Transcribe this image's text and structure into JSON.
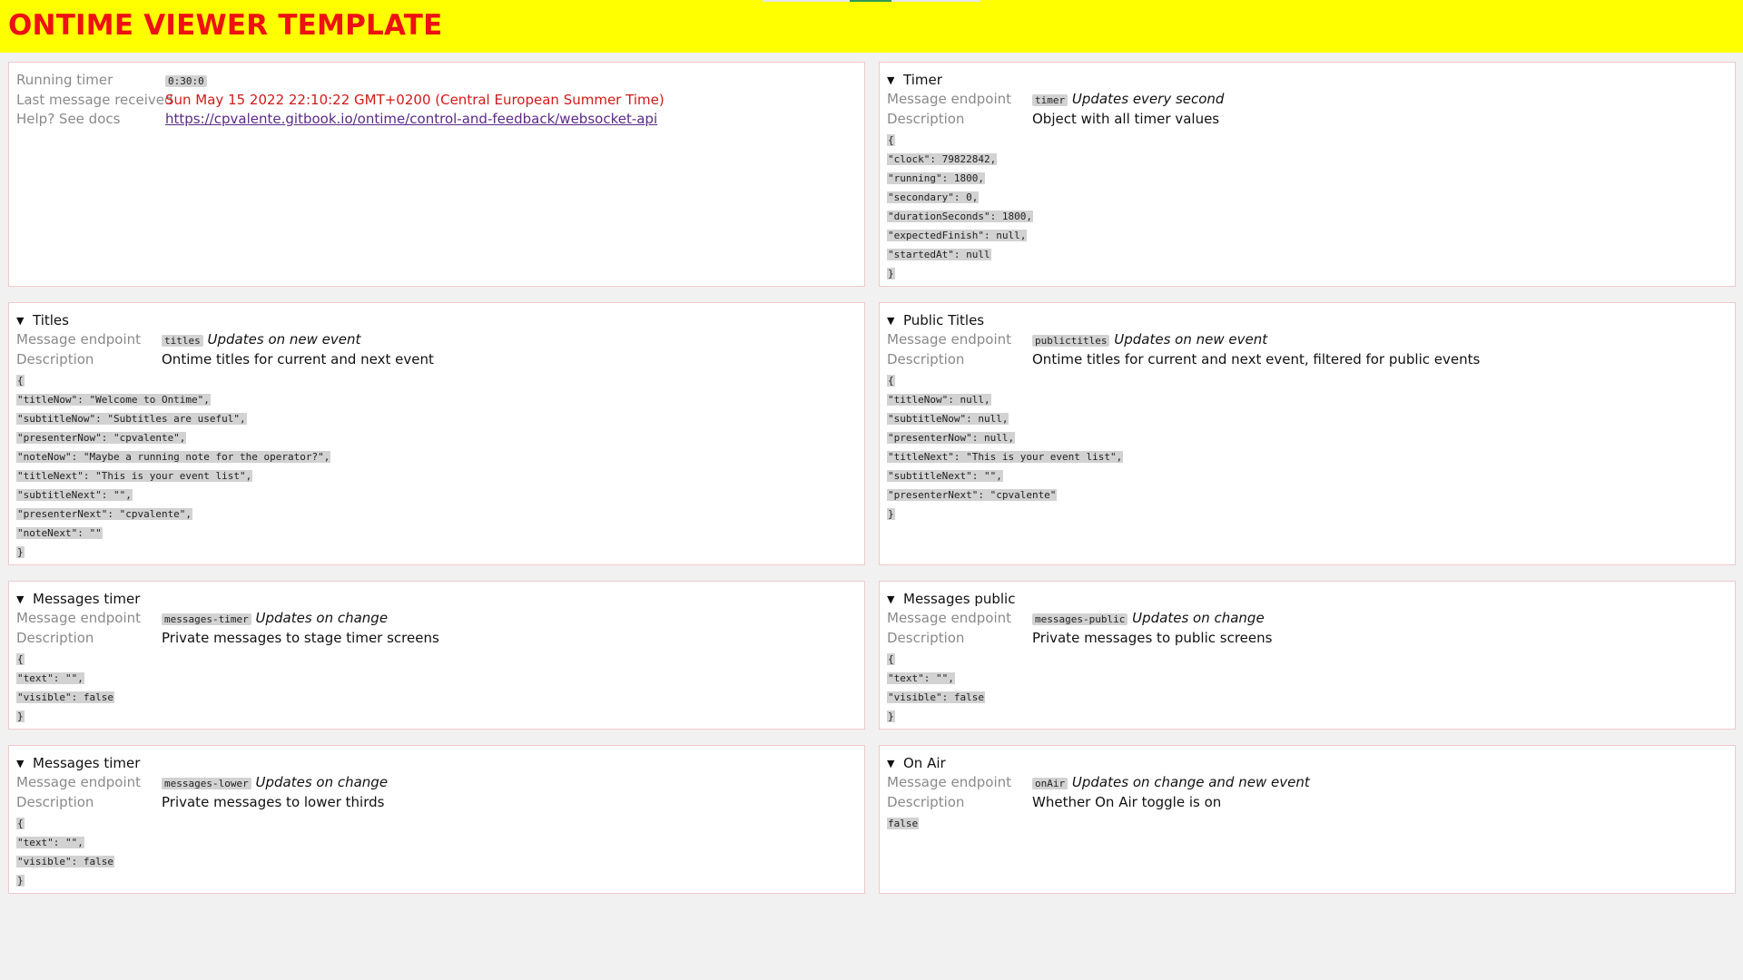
{
  "header": {
    "title": "ONTIME VIEWER TEMPLATE"
  },
  "status": {
    "running_timer_label": "Running timer",
    "running_timer_value": "0:30:0",
    "last_message_label": "Last message received",
    "last_message_value": "Sun May 15 2022 22:10:22 GMT+0200 (Central European Summer Time)",
    "help_label": "Help? See docs",
    "help_link": "https://cpvalente.gitbook.io/ontime/control-and-feedback/websocket-api"
  },
  "labels": {
    "endpoint": "Message endpoint",
    "description": "Description"
  },
  "timer": {
    "title": "Timer",
    "endpoint": "timer",
    "update": "Updates every second",
    "description": "Object with all timer values",
    "json": [
      "{",
      "\"clock\": 79822842,",
      "\"running\": 1800,",
      "\"secondary\": 0,",
      "\"durationSeconds\": 1800,",
      "\"expectedFinish\": null,",
      "\"startedAt\": null",
      "}"
    ]
  },
  "titles": {
    "title": "Titles",
    "endpoint": "titles",
    "update": "Updates on new event",
    "description": "Ontime titles for current and next event",
    "json": [
      "{",
      "\"titleNow\": \"Welcome to Ontime\",",
      "\"subtitleNow\": \"Subtitles are useful\",",
      "\"presenterNow\": \"cpvalente\",",
      "\"noteNow\": \"Maybe a running note for the operator?\",",
      "\"titleNext\": \"This is your event list\",",
      "\"subtitleNext\": \"\",",
      "\"presenterNext\": \"cpvalente\",",
      "\"noteNext\": \"\"",
      "}"
    ]
  },
  "public_titles": {
    "title": "Public Titles",
    "endpoint": "publictitles",
    "update": "Updates on new event",
    "description": "Ontime titles for current and next event, filtered for public events",
    "json": [
      "{",
      "\"titleNow\": null,",
      "\"subtitleNow\": null,",
      "\"presenterNow\": null,",
      "\"titleNext\": \"This is your event list\",",
      "\"subtitleNext\": \"\",",
      "\"presenterNext\": \"cpvalente\"",
      "}"
    ]
  },
  "messages_timer": {
    "title": "Messages timer",
    "endpoint": "messages-timer",
    "update": "Updates on change",
    "description": "Private messages to stage timer screens",
    "json": [
      "{",
      "\"text\": \"\",",
      "\"visible\": false",
      "}"
    ]
  },
  "messages_public": {
    "title": "Messages public",
    "endpoint": "messages-public",
    "update": "Updates on change",
    "description": "Private messages to public screens",
    "json": [
      "{",
      "\"text\": \"\",",
      "\"visible\": false",
      "}"
    ]
  },
  "messages_lower": {
    "title": "Messages timer",
    "endpoint": "messages-lower",
    "update": "Updates on change",
    "description": "Private messages to lower thirds",
    "json": [
      "{",
      "\"text\": \"\",",
      "\"visible\": false",
      "}"
    ]
  },
  "on_air": {
    "title": "On Air",
    "endpoint": "onAir",
    "update": "Updates on change and new event",
    "description": "Whether On Air toggle is on",
    "json": [
      "false"
    ]
  }
}
